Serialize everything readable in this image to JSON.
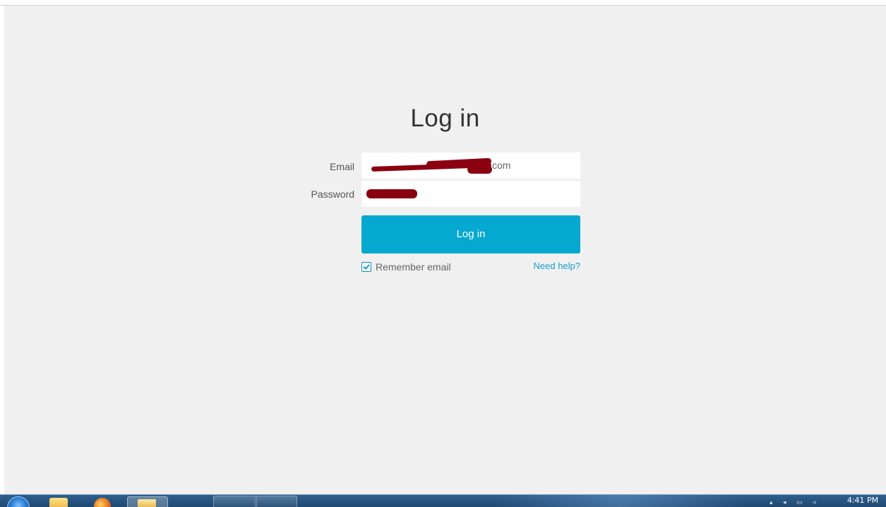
{
  "login": {
    "title": "Log in",
    "email_label": "Email",
    "email_value_visible_tail": "com",
    "password_label": "Password",
    "submit_label": "Log in",
    "remember_label": "Remember email",
    "remember_checked": true,
    "help_link": "Need help?"
  },
  "taskbar": {
    "clock_time": "4:41 PM"
  },
  "colors": {
    "page_background": "#f0f0f0",
    "button_accent": "#05a8cf",
    "link": "#16a0d0",
    "redaction": "#8a0010"
  },
  "icons": {
    "checkbox": "checkmark-icon",
    "start": "windows-start-icon",
    "explorer": "folder-icon",
    "browser": "firefox-icon"
  }
}
